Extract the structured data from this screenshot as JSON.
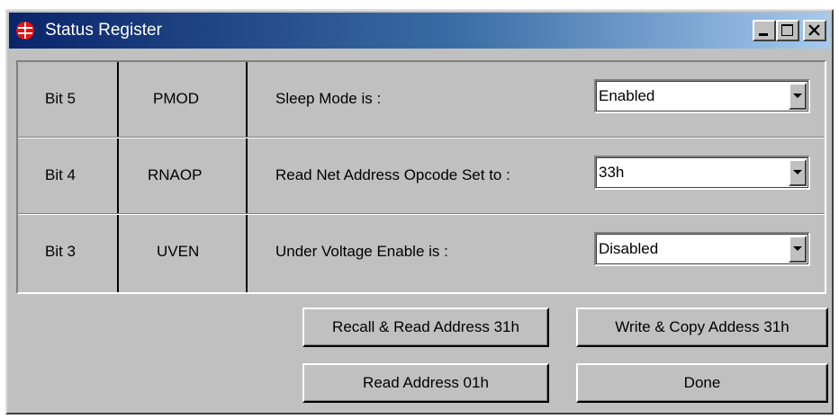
{
  "window": {
    "title": "Status Register",
    "icon": "app-logo-icon",
    "controls": {
      "minimize_icon": "minimize-icon",
      "maximize_icon": "maximize-icon",
      "close_icon": "close-icon"
    }
  },
  "rows": [
    {
      "bit": "Bit 5",
      "name": "PMOD",
      "label": "Sleep Mode is :",
      "value": "Enabled"
    },
    {
      "bit": "Bit 4",
      "name": "RNAOP",
      "label": "Read Net Address Opcode Set to :",
      "value": "33h"
    },
    {
      "bit": "Bit 3",
      "name": "UVEN",
      "label": "Under Voltage Enable is :",
      "value": "Disabled"
    }
  ],
  "buttons": {
    "recall": "Recall & Read Address 31h",
    "write": "Write & Copy Addess 31h",
    "read": "Read Address 01h",
    "done": "Done"
  },
  "colors": {
    "titlebar_start": "#0a246a",
    "titlebar_end": "#a6caf0",
    "face": "#c0c0c0",
    "logo_red": "#e8110f"
  }
}
